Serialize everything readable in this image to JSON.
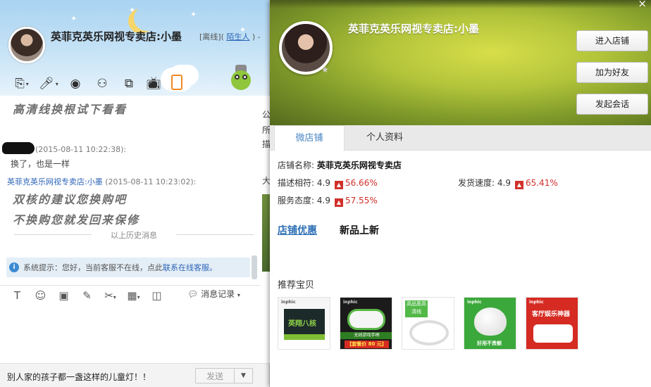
{
  "chat": {
    "title": "英菲克英乐网视专卖店:小墨",
    "status_prefix": "[离线]( ",
    "status_link": "陌生人",
    "status_suffix": " ) -",
    "messages": [
      {
        "type": "big",
        "text": "高清线换根试下看看"
      },
      {
        "type": "meta",
        "sender": "",
        "time": "(2015-08-11 10:22:38):"
      },
      {
        "type": "plain",
        "text": "换了，也是一样"
      },
      {
        "type": "meta",
        "sender": "英菲克英乐网视专卖店:小墨",
        "time": "(2015-08-11 10:23:02):"
      },
      {
        "type": "big",
        "text": "双核的建议您换购吧"
      },
      {
        "type": "big",
        "text": "不换购您就发回来保修"
      }
    ],
    "history_divider": "以上历史消息",
    "system_notice": "系统提示：您好，当前客服不在线，点此",
    "system_link": "联系在线客服。",
    "history_label": "消息记录",
    "ad_text": "别人家的孩子都一盏这样的儿童灯！！",
    "send_label": "发送"
  },
  "middle_peek": [
    "公",
    "所",
    "描",
    "大"
  ],
  "profile": {
    "name": "英菲克英乐网视专卖店:小墨",
    "buttons": [
      "进入店铺",
      "加为好友",
      "发起会话"
    ],
    "tabs": [
      {
        "label": "微店铺",
        "active": true
      },
      {
        "label": "个人资料",
        "active": false
      }
    ],
    "shop_name_label": "店铺名称:",
    "shop_name": "英菲克英乐网视专卖店",
    "ratings": [
      {
        "label": "描述相符:",
        "score": "4.9",
        "pct": "56.66%"
      },
      {
        "label": "发货速度:",
        "score": "4.9",
        "pct": "65.41%"
      },
      {
        "label": "服务态度:",
        "score": "4.9",
        "pct": "57.55%"
      }
    ],
    "links": {
      "promo": "店铺优惠",
      "new": "新品上新"
    },
    "recommend_title": "推荐宝贝",
    "products": [
      {
        "brand": "inphic",
        "label": "英翔八核"
      },
      {
        "brand": "inphic",
        "label1": "无线游戏手柄",
        "label2": "【套餐价 80 元】"
      },
      {
        "label": "高品质高清线"
      },
      {
        "brand": "inphic",
        "label": "好用不贵额"
      },
      {
        "brand": "inphic",
        "label": "客厅娱乐神器"
      }
    ]
  },
  "colors": {
    "accent": "#2c65b8",
    "up_red": "#d1302a",
    "banner_green": "#b2c43a"
  }
}
